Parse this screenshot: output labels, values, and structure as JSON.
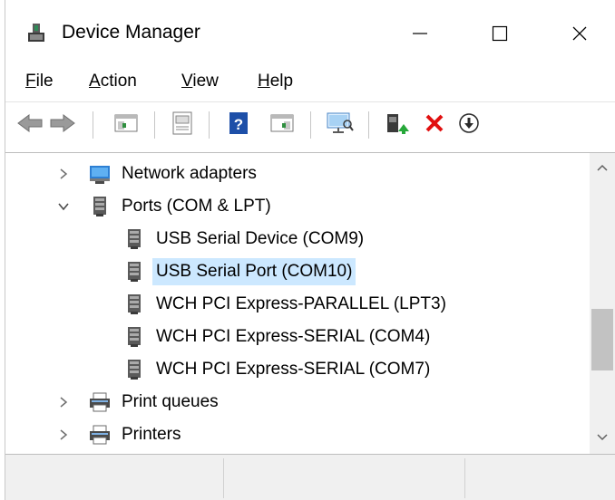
{
  "window": {
    "title": "Device Manager",
    "controls": {
      "minimize": "—",
      "maximize": "☐",
      "close": "✕"
    }
  },
  "menu": {
    "items": [
      {
        "accel": "F",
        "rest": "ile"
      },
      {
        "accel": "A",
        "rest": "ction"
      },
      {
        "accel": "V",
        "rest": "iew"
      },
      {
        "accel": "H",
        "rest": "elp"
      }
    ]
  },
  "toolbar": {
    "icons": [
      "back-arrow-icon",
      "forward-arrow-icon",
      "show-hide-console-tree-icon",
      "properties-sheet-icon",
      "help-icon",
      "action-pane-icon",
      "scan-hardware-icon",
      "update-driver-icon",
      "uninstall-device-icon",
      "disable-device-icon"
    ]
  },
  "tree": {
    "nodes": [
      {
        "label": "Network adapters",
        "expanded": false,
        "icon": "network-adapter-icon"
      },
      {
        "label": "Ports (COM & LPT)",
        "expanded": true,
        "icon": "port-connector-icon"
      },
      {
        "label": "USB Serial Device (COM9)",
        "child": true,
        "icon": "port-connector-icon"
      },
      {
        "label": "USB Serial Port (COM10)",
        "child": true,
        "selected": true,
        "icon": "port-connector-icon"
      },
      {
        "label": "WCH PCI Express-PARALLEL (LPT3)",
        "child": true,
        "icon": "port-connector-icon"
      },
      {
        "label": "WCH PCI Express-SERIAL (COM4)",
        "child": true,
        "icon": "port-connector-icon"
      },
      {
        "label": "WCH PCI Express-SERIAL (COM7)",
        "child": true,
        "icon": "port-connector-icon"
      },
      {
        "label": "Print queues",
        "expanded": false,
        "icon": "printer-icon"
      },
      {
        "label": "Printers",
        "expanded": false,
        "icon": "printer-icon"
      }
    ]
  },
  "status": {
    "cells": [
      "",
      "",
      ""
    ]
  },
  "colors": {
    "selection": "#cce8ff",
    "accent_green": "#27a83a",
    "danger": "#e11010",
    "help_blue": "#1d4fa8"
  }
}
